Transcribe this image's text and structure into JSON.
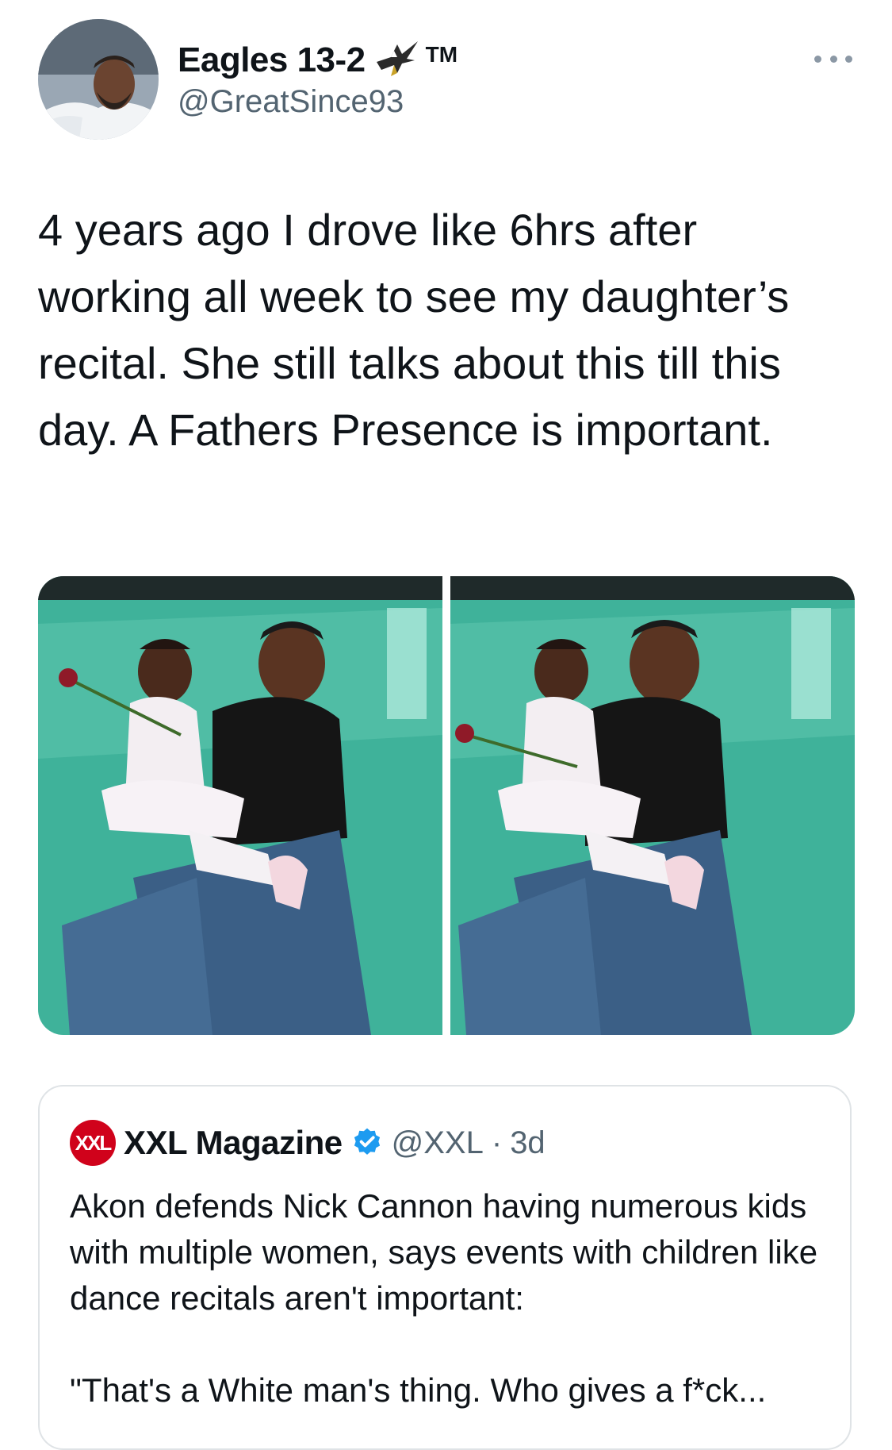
{
  "tweet": {
    "author": {
      "display_name": "Eagles 13-2",
      "trademark": "TM",
      "handle": "@GreatSince93"
    },
    "more_label": "More",
    "text": "4 years ago I drove like 6hrs after working all week to see my daughter’s recital. She still talks about this till this day. A Fathers Presence is important.",
    "media": [
      {
        "alt": "Father sitting on a stage floor with his daughter in a white ballet outfit holding a rose"
      },
      {
        "alt": "Father and daughter smiling at the camera on a stage floor"
      }
    ]
  },
  "quote": {
    "logo_text": "XXL",
    "name": "XXL Magazine",
    "handle": "@XXL",
    "separator": "·",
    "time": "3d",
    "text": "Akon defends Nick Cannon having numerous kids with multiple women, says events with children like dance recitals aren't important:\n\n\"That's a White man's thing. Who gives a f*ck..."
  },
  "colors": {
    "text_primary": "#0f1419",
    "text_secondary": "#536471",
    "verified_blue": "#1d9bf0",
    "xxl_red": "#d0021b",
    "border": "#dfe3e6"
  },
  "icons": [
    "eagle-icon",
    "more-icon",
    "verified-icon"
  ]
}
